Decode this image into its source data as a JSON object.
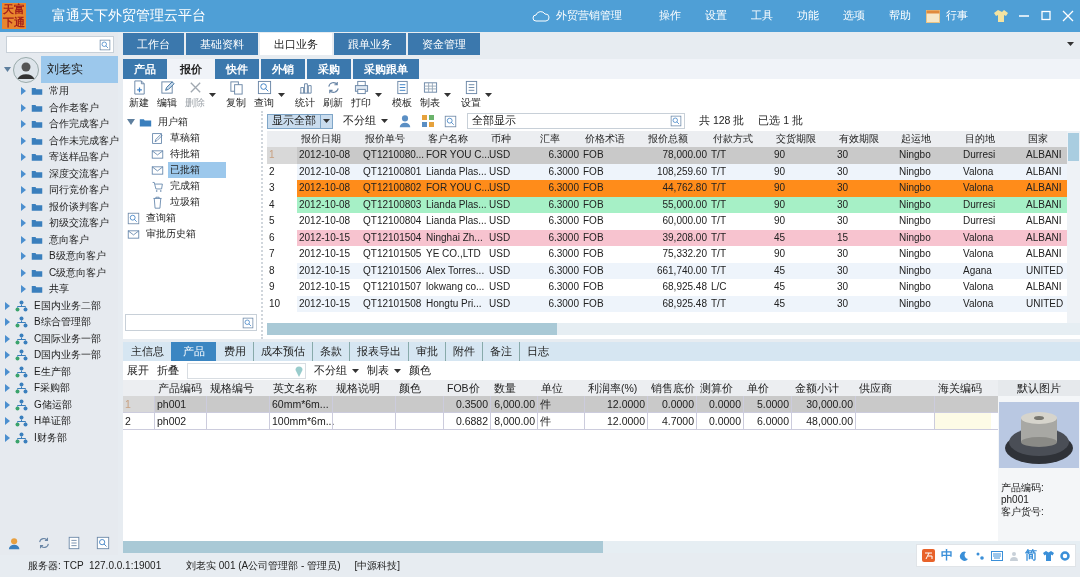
{
  "window": {
    "title": "富通天下外贸管理云平台",
    "logo": "天富下通"
  },
  "title_bar": {
    "cloud_link": "外贸营销管理",
    "menus": [
      "操作",
      "设置",
      "工具",
      "功能",
      "选项",
      "帮助"
    ],
    "calendar": "行事"
  },
  "sidebar": {
    "tree": [
      {
        "label": "刘老实",
        "kind": "user",
        "expanded": true,
        "selected": true,
        "children": [
          {
            "label": "常用",
            "kind": "folder",
            "expanded": false,
            "selected": false
          },
          {
            "label": "合作老客户",
            "kind": "folder",
            "expanded": false,
            "selected": false
          },
          {
            "label": "合作完成客户",
            "kind": "folder",
            "expanded": false,
            "selected": false
          },
          {
            "label": "合作未完成客户",
            "kind": "folder",
            "expanded": false,
            "selected": false
          },
          {
            "label": "寄送样品客户",
            "kind": "folder",
            "expanded": false,
            "selected": false
          },
          {
            "label": "深度交流客户",
            "kind": "folder",
            "expanded": false,
            "selected": false
          },
          {
            "label": "同行竞价客户",
            "kind": "folder",
            "expanded": false,
            "selected": false
          },
          {
            "label": "报价谈判客户",
            "kind": "folder",
            "expanded": false,
            "selected": false
          },
          {
            "label": "初级交流客户",
            "kind": "folder",
            "expanded": false,
            "selected": false
          },
          {
            "label": "意向客户",
            "kind": "folder",
            "expanded": false,
            "selected": false
          },
          {
            "label": "B级意向客户",
            "kind": "folder",
            "expanded": false,
            "selected": false
          },
          {
            "label": "C级意向客户",
            "kind": "folder",
            "expanded": false,
            "selected": false
          },
          {
            "label": "共享",
            "kind": "folder",
            "expanded": false,
            "selected": false
          }
        ]
      },
      {
        "label": "E国内业务二部",
        "kind": "department",
        "expanded": false,
        "selected": false
      },
      {
        "label": "B综合管理部",
        "kind": "department",
        "expanded": false,
        "selected": false
      },
      {
        "label": "C国际业务一部",
        "kind": "department",
        "expanded": false,
        "selected": false
      },
      {
        "label": "D国内业务一部",
        "kind": "department",
        "expanded": false,
        "selected": false
      },
      {
        "label": "E生产部",
        "kind": "department",
        "expanded": false,
        "selected": false
      },
      {
        "label": "F采购部",
        "kind": "department",
        "expanded": false,
        "selected": false
      },
      {
        "label": "G储运部",
        "kind": "department",
        "expanded": false,
        "selected": false
      },
      {
        "label": "H单证部",
        "kind": "department",
        "expanded": false,
        "selected": false
      },
      {
        "label": "I财务部",
        "kind": "department",
        "expanded": false,
        "selected": false
      }
    ]
  },
  "module_tabs": [
    {
      "label": "工作台",
      "selected": false
    },
    {
      "label": "基础资料",
      "selected": false
    },
    {
      "label": "出口业务",
      "selected": true
    },
    {
      "label": "跟单业务",
      "selected": false
    },
    {
      "label": "资金管理",
      "selected": false
    }
  ],
  "sub_tabs": [
    {
      "label": "产品",
      "selected": false
    },
    {
      "label": "报价",
      "selected": true
    },
    {
      "label": "快件",
      "selected": false
    },
    {
      "label": "外销",
      "selected": false
    },
    {
      "label": "采购",
      "selected": false
    },
    {
      "label": "采购跟单",
      "selected": false
    }
  ],
  "toolbar": [
    {
      "label": "新建",
      "kind": "new",
      "disabled": false,
      "dropdown": false
    },
    {
      "label": "编辑",
      "kind": "edit",
      "disabled": false,
      "dropdown": false
    },
    {
      "label": "删除",
      "kind": "delete",
      "disabled": true,
      "dropdown": true
    },
    {
      "label": "复制",
      "kind": "copy",
      "disabled": false,
      "dropdown": false
    },
    {
      "label": "查询",
      "kind": "search",
      "disabled": false,
      "dropdown": true
    },
    {
      "label": "统计",
      "kind": "chart",
      "disabled": false,
      "dropdown": false
    },
    {
      "label": "刷新",
      "kind": "refresh",
      "disabled": false,
      "dropdown": false
    },
    {
      "label": "打印",
      "kind": "print",
      "disabled": false,
      "dropdown": true
    },
    {
      "label": "模板",
      "kind": "template",
      "disabled": false,
      "dropdown": false
    },
    {
      "label": "制表",
      "kind": "table",
      "disabled": false,
      "dropdown": true
    },
    {
      "label": "设置",
      "kind": "settings",
      "disabled": false,
      "dropdown": true
    }
  ],
  "mail_tree": [
    {
      "label": "用户箱",
      "kind": "folder",
      "expanded": true,
      "selected": false,
      "children": [
        {
          "label": "草稿箱",
          "kind": "draft",
          "selected": false
        },
        {
          "label": "待批箱",
          "kind": "mail",
          "selected": false
        },
        {
          "label": "已批箱",
          "kind": "mail",
          "selected": true
        },
        {
          "label": "完成箱",
          "kind": "cart",
          "selected": false
        },
        {
          "label": "垃圾箱",
          "kind": "trash",
          "selected": false
        }
      ]
    },
    {
      "label": "查询箱",
      "kind": "search",
      "selected": false
    },
    {
      "label": "审批历史箱",
      "kind": "history",
      "selected": false
    }
  ],
  "filter_bar": {
    "view": "显示全部",
    "group": "不分组",
    "search_value": "全部显示",
    "total": "共 128 批",
    "selected_count": "已选 1 批"
  },
  "quotes": {
    "columns": [
      {
        "label": "报价日期",
        "kind": "text"
      },
      {
        "label": "报价单号",
        "kind": "text"
      },
      {
        "label": "客户名称",
        "kind": "text"
      },
      {
        "label": "币种",
        "kind": "text"
      },
      {
        "label": "汇率",
        "kind": "number"
      },
      {
        "label": "价格术语",
        "kind": "text"
      },
      {
        "label": "报价总额",
        "kind": "number"
      },
      {
        "label": "付款方式",
        "kind": "text"
      },
      {
        "label": "交货期限",
        "kind": "text"
      },
      {
        "label": "有效期限",
        "kind": "text"
      },
      {
        "label": "起运地",
        "kind": "text"
      },
      {
        "label": "目的地",
        "kind": "text"
      },
      {
        "label": "国家",
        "kind": "text"
      }
    ],
    "rows": [
      {
        "no": "1",
        "selected": true,
        "cells": [
          "2012-10-08",
          "QT1210080...",
          "FOR YOU C...",
          "USD",
          "6.3000",
          "FOB",
          "78,000.00",
          "T/T",
          "90",
          "30",
          "Ningbo",
          "Durresi",
          "ALBANI"
        ]
      },
      {
        "no": "2",
        "selected": false,
        "cells": [
          "2012-10-08",
          "QT12100801",
          "Lianda Plas...",
          "USD",
          "6.3000",
          "FOB",
          "108,259.60",
          "T/T",
          "90",
          "30",
          "Ningbo",
          "Valona",
          "ALBANI"
        ]
      },
      {
        "no": "3",
        "selected": false,
        "color": "#ff8c1a",
        "cells": [
          "2012-10-08",
          "QT12100802",
          "FOR YOU C...",
          "USD",
          "6.3000",
          "FOB",
          "44,762.80",
          "T/T",
          "90",
          "30",
          "Ningbo",
          "Valona",
          "ALBANI"
        ]
      },
      {
        "no": "4",
        "selected": false,
        "color": "#a6f0c6",
        "cells": [
          "2012-10-08",
          "QT12100803",
          "Lianda Plas...",
          "USD",
          "6.3000",
          "FOB",
          "55,000.00",
          "T/T",
          "90",
          "30",
          "Ningbo",
          "Durresi",
          "ALBANI"
        ]
      },
      {
        "no": "5",
        "selected": false,
        "cells": [
          "2012-10-08",
          "QT12100804",
          "Lianda Plas...",
          "USD",
          "6.3000",
          "FOB",
          "60,000.00",
          "T/T",
          "90",
          "30",
          "Ningbo",
          "Durresi",
          "ALBANI"
        ]
      },
      {
        "no": "6",
        "selected": false,
        "color": "#f7c3cf",
        "cells": [
          "2012-10-15",
          "QT12101504",
          "Ninghai Zh...",
          "USD",
          "6.3000",
          "FOB",
          "39,208.00",
          "T/T",
          "45",
          "15",
          "Ningbo",
          "Valona",
          "ALBANI"
        ]
      },
      {
        "no": "7",
        "selected": false,
        "cells": [
          "2012-10-15",
          "QT12101505",
          "YE CO.,LTD",
          "USD",
          "6.3000",
          "FOB",
          "75,332.20",
          "T/T",
          "90",
          "30",
          "Ningbo",
          "Valona",
          "ALBANI"
        ]
      },
      {
        "no": "8",
        "selected": false,
        "cells": [
          "2012-10-15",
          "QT12101506",
          "Alex Torres...",
          "USD",
          "6.3000",
          "FOB",
          "661,740.00",
          "T/T",
          "45",
          "30",
          "Ningbo",
          "Agana",
          "UNITED"
        ]
      },
      {
        "no": "9",
        "selected": false,
        "cells": [
          "2012-10-15",
          "QT12101507",
          "lokwang co...",
          "USD",
          "6.3000",
          "FOB",
          "68,925.48",
          "L/C",
          "45",
          "30",
          "Ningbo",
          "Valona",
          "ALBANI"
        ]
      },
      {
        "no": "10",
        "selected": false,
        "cells": [
          "2012-10-15",
          "QT12101508",
          "Hongtu Pri...",
          "USD",
          "6.3000",
          "FOB",
          "68,925.48",
          "T/T",
          "45",
          "30",
          "Ningbo",
          "Valona",
          "UNITED"
        ]
      }
    ]
  },
  "detail_tabs": [
    {
      "label": "主信息",
      "selected": false
    },
    {
      "label": "产品",
      "selected": true
    },
    {
      "label": "费用",
      "selected": false
    },
    {
      "label": "成本预估",
      "selected": false
    },
    {
      "label": "条款",
      "selected": false
    },
    {
      "label": "报表导出",
      "selected": false
    },
    {
      "label": "审批",
      "selected": false
    },
    {
      "label": "附件",
      "selected": false
    },
    {
      "label": "备注",
      "selected": false
    },
    {
      "label": "日志",
      "selected": false
    }
  ],
  "detail_bar": {
    "expand": "展开",
    "collapse": "折叠",
    "group": "不分组",
    "chart": "制表",
    "color_button": "颜色"
  },
  "products": {
    "columns": [
      {
        "label": "产品编码",
        "kind": "text"
      },
      {
        "label": "规格编号",
        "kind": "text"
      },
      {
        "label": "英文名称",
        "kind": "text"
      },
      {
        "label": "规格说明",
        "kind": "text"
      },
      {
        "label": "颜色",
        "kind": "text"
      },
      {
        "label": "FOB价",
        "kind": "number"
      },
      {
        "label": "数量",
        "kind": "number"
      },
      {
        "label": "单位",
        "kind": "text"
      },
      {
        "label": "利润率(%)",
        "kind": "number"
      },
      {
        "label": "销售底价",
        "kind": "number"
      },
      {
        "label": "测算价",
        "kind": "number"
      },
      {
        "label": "单价",
        "kind": "number"
      },
      {
        "label": "金额小计",
        "kind": "number"
      },
      {
        "label": "供应商",
        "kind": "text"
      },
      {
        "label": "海关编码",
        "kind": "text"
      }
    ],
    "rows": [
      {
        "no": "1",
        "selected": true,
        "cells": [
          "ph001",
          "",
          "60mm*6m...",
          "",
          "",
          "0.3500",
          "6,000.00",
          "件",
          "12.0000",
          "0.0000",
          "0.0000",
          "5.0000",
          "30,000.00",
          "",
          ""
        ]
      },
      {
        "no": "2",
        "selected": false,
        "cells": [
          "ph002",
          "",
          "100mm*6m...",
          "",
          "",
          "0.6882",
          "8,000.00",
          "件",
          "12.0000",
          "4.7000",
          "0.0000",
          "6.0000",
          "48,000.00",
          "",
          ""
        ]
      }
    ]
  },
  "image_panel": {
    "title": "默认图片",
    "code_label": "产品编码:",
    "code": "ph001",
    "customer_code_label": "客户货号:"
  },
  "status_bar": {
    "server": "服务器: TCP  127.0.0.1:19001",
    "user": "刘老实 001 (A公司管理部 - 管理员)",
    "company": "[中源科技]"
  },
  "ime_bar": {
    "language": "中",
    "script": "简"
  }
}
